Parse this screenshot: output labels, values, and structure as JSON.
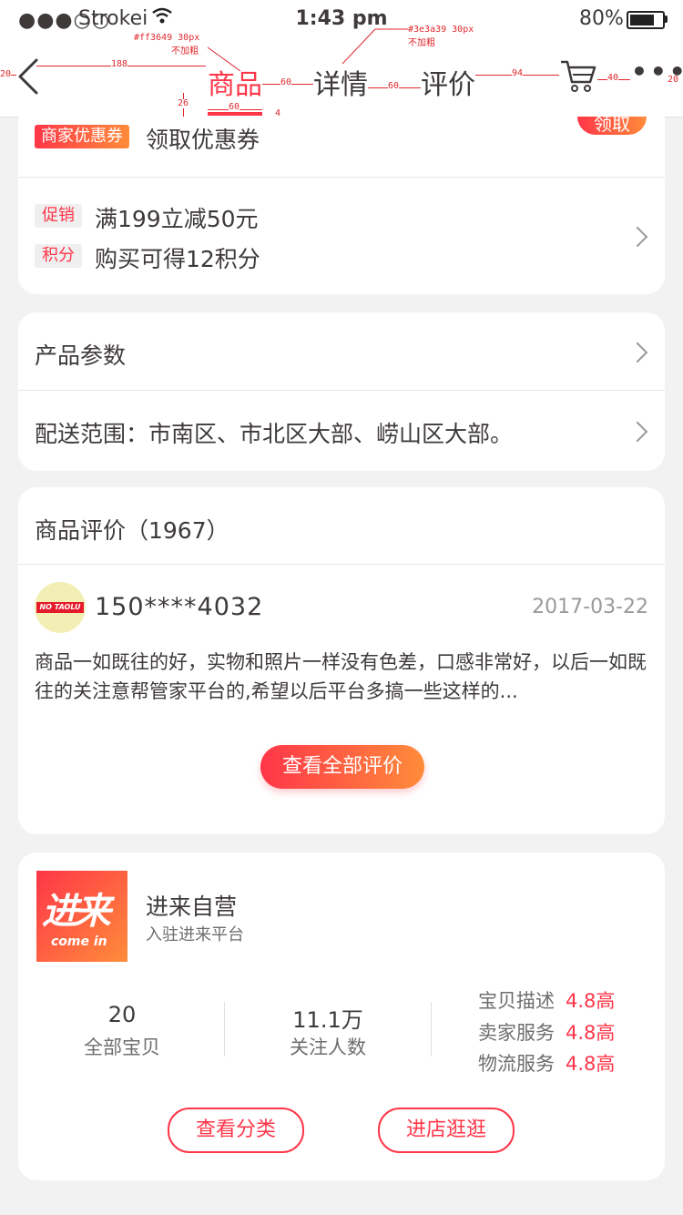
{
  "status_bar": {
    "signal": "●●●○○",
    "carrier": "Strokei",
    "time": "1:43 pm",
    "battery_percent": "80%",
    "battery_level": 0.8
  },
  "nav": {
    "tabs": [
      "商品",
      "详情",
      "评价"
    ],
    "active_tab": 0,
    "active_color": "#ff3649",
    "text_color": "#3e3a39",
    "more": "•••"
  },
  "annotations": {
    "active_color_note": "#ff3649  30px",
    "active_weight_note": "不加粗",
    "inactive_color_note": "#3e3a39  30px",
    "inactive_weight_note": "不加粗",
    "left_pad": "20",
    "back_gap": "188",
    "tab_gap_1": "60",
    "tab_gap_2": "60",
    "cart_gap": "94",
    "more_gap": "40",
    "right_pad": "20",
    "underline_offset": "26",
    "underline_width": "60",
    "underline_height": "4"
  },
  "coupon": {
    "badge": "商家优惠券",
    "text": "领取优惠券",
    "claim_button": "领取"
  },
  "promos": [
    {
      "tag": "促销",
      "text": "满199立减50元"
    },
    {
      "tag": "积分",
      "text": "购买可得12积分"
    }
  ],
  "params": {
    "product_params": "产品参数",
    "delivery": "配送范围：市南区、市北区大部、崂山区大部。"
  },
  "reviews": {
    "title": "商品评价（1967）",
    "avatar_text": "NO TAOLU",
    "reviewer": "150****4032",
    "date": "2017-03-22",
    "body": "商品一如既往的好，实物和照片一样没有色差，口感非常好，以后一如既往的关注意帮管家平台的,希望以后平台多搞一些这样的...",
    "view_all": "查看全部评价"
  },
  "shop": {
    "logo_big": "进来",
    "logo_small": "come in",
    "name": "进来自营",
    "subtitle": "入驻进来平台",
    "stats": [
      {
        "value": "20",
        "label": "全部宝贝"
      },
      {
        "value": "11.1万",
        "label": "关注人数"
      }
    ],
    "ratings": [
      {
        "label": "宝贝描述",
        "value": "4.8高"
      },
      {
        "label": "卖家服务",
        "value": "4.8高"
      },
      {
        "label": "物流服务",
        "value": "4.8高"
      }
    ],
    "btn_category": "查看分类",
    "btn_visit": "进店逛逛"
  }
}
